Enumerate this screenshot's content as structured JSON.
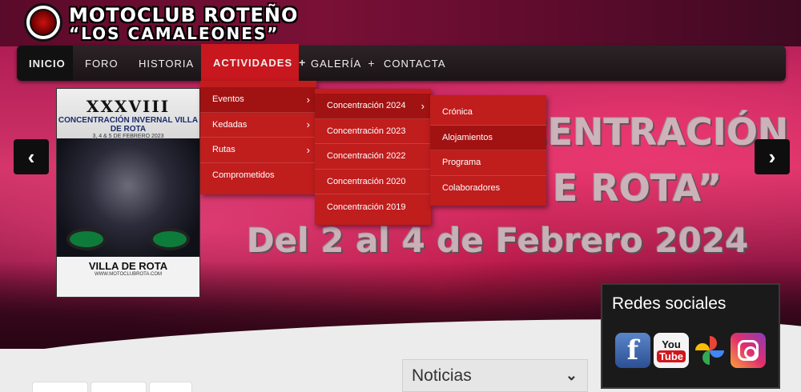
{
  "header": {
    "brand_line1": "MOTOCLUB ROTEÑO",
    "brand_line2": "“LOS CAMALEONES”"
  },
  "nav": {
    "items": [
      {
        "label": "INICIO"
      },
      {
        "label": "FORO"
      },
      {
        "label": "HISTORIA"
      },
      {
        "label": "ACTIVIDADES",
        "plus": "+"
      },
      {
        "label": "GALERÍA",
        "plus": "+"
      },
      {
        "label": "CONTACTA"
      }
    ]
  },
  "menu_actividades": [
    {
      "label": "Eventos",
      "chev": "›"
    },
    {
      "label": "Kedadas",
      "chev": "›"
    },
    {
      "label": "Rutas",
      "chev": "›"
    },
    {
      "label": "Comprometidos"
    }
  ],
  "menu_eventos": [
    {
      "label": "Concentración 2024",
      "chev": "›"
    },
    {
      "label": "Concentración 2023"
    },
    {
      "label": "Concentración 2022"
    },
    {
      "label": "Concentración 2020"
    },
    {
      "label": "Concentración 2019"
    }
  ],
  "menu_concentracion_2024": [
    {
      "label": "Crónica"
    },
    {
      "label": "Alojamientos"
    },
    {
      "label": "Programa"
    },
    {
      "label": "Colaboradores"
    }
  ],
  "hero": {
    "line1": "CENTRACIÓN",
    "line2": "E ROTA”",
    "line3": "Del 2 al 4 de Febrero 2024",
    "prev_arrow": "‹",
    "next_arrow": "›"
  },
  "poster": {
    "roman": "XXXVIII",
    "title": "CONCENTRACIÓN INVERNAL VILLA DE ROTA",
    "date": "3, 4 & 5 DE FEBRERO 2023",
    "bottom": "VILLA DE ROTA",
    "web": "WWW.MOTOCLUBROTA.COM"
  },
  "social": {
    "title": "Redes sociales",
    "facebook": "f",
    "youtube_you": "You",
    "youtube_tube": "Tube"
  },
  "noticias": {
    "title": "Noticias",
    "chev": "⌄"
  }
}
